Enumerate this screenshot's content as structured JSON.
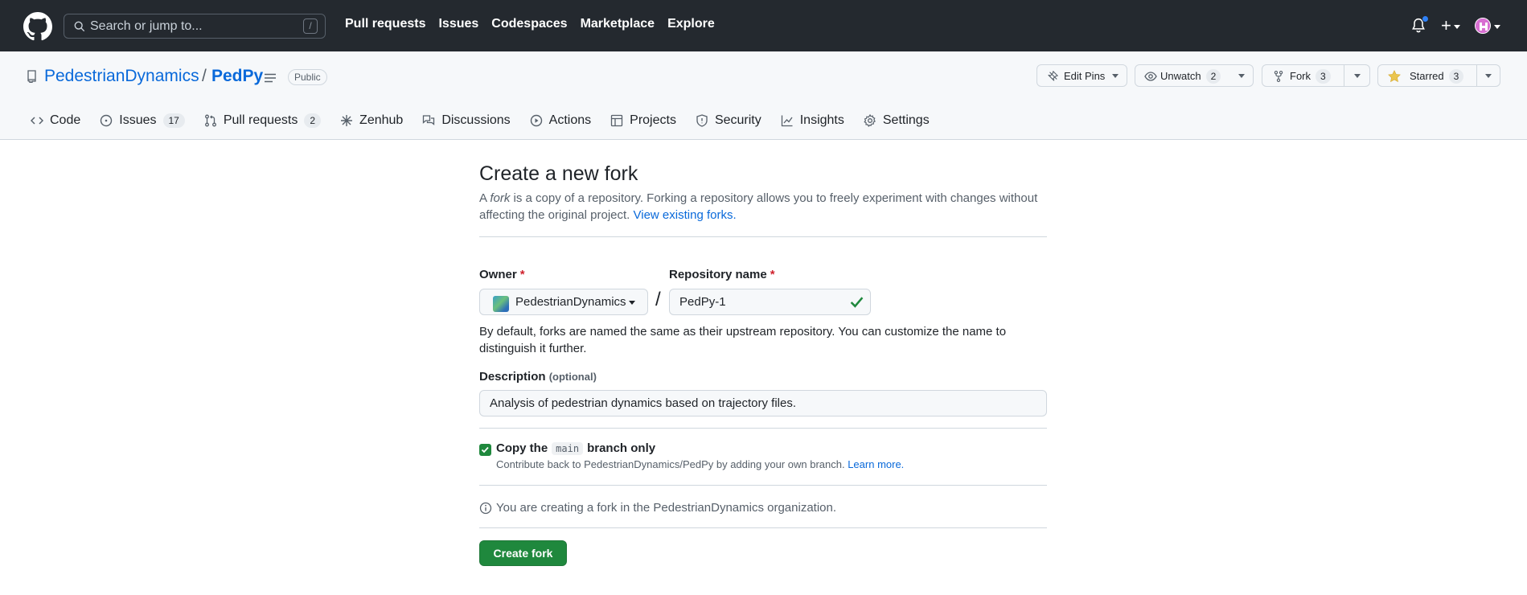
{
  "header": {
    "search_placeholder": "Search or jump to...",
    "search_shortcut": "/",
    "nav": [
      "Pull requests",
      "Issues",
      "Codespaces",
      "Marketplace",
      "Explore"
    ],
    "plus_label": "+"
  },
  "repo": {
    "owner": "PedestrianDynamics",
    "separator": "/",
    "name": "PedPy",
    "visibility": "Public",
    "edit_pins_label": "Edit Pins",
    "unwatch_label": "Unwatch",
    "unwatch_count": "2",
    "fork_label": "Fork",
    "fork_count": "3",
    "starred_label": "Starred",
    "starred_count": "3"
  },
  "tabs": [
    {
      "label": "Code",
      "count": ""
    },
    {
      "label": "Issues",
      "count": "17"
    },
    {
      "label": "Pull requests",
      "count": "2"
    },
    {
      "label": "Zenhub",
      "count": ""
    },
    {
      "label": "Discussions",
      "count": ""
    },
    {
      "label": "Actions",
      "count": ""
    },
    {
      "label": "Projects",
      "count": ""
    },
    {
      "label": "Security",
      "count": ""
    },
    {
      "label": "Insights",
      "count": ""
    },
    {
      "label": "Settings",
      "count": ""
    }
  ],
  "form": {
    "title": "Create a new fork",
    "subtitle_a": "A ",
    "subtitle_em": "fork",
    "subtitle_b": " is a copy of a repository. Forking a repository allows you to freely experiment with changes without affecting the original project. ",
    "view_forks_link": "View existing forks.",
    "owner_label": "Owner",
    "required_mark": "*",
    "owner_value": "PedestrianDynamics",
    "repo_name_label": "Repository name",
    "repo_name_value": "PedPy-1",
    "name_hint": "By default, forks are named the same as their upstream repository. You can customize the name to distinguish it further.",
    "description_label": "Description",
    "description_optional": "(optional)",
    "description_value": "Analysis of pedestrian dynamics based on trajectory files.",
    "copy_branch_prefix": "Copy the",
    "copy_branch_code": "main",
    "copy_branch_suffix": "branch only",
    "copy_branch_checked": true,
    "copy_branch_note": "Contribute back to PedestrianDynamics/PedPy by adding your own branch.",
    "learn_more_link": "Learn more.",
    "info_text": "You are creating a fork in the PedestrianDynamics organization.",
    "create_button": "Create fork"
  },
  "colors": {
    "header_bg": "#24292f",
    "link": "#0969da",
    "primary_button": "#1f883d",
    "required": "#cf222e"
  }
}
